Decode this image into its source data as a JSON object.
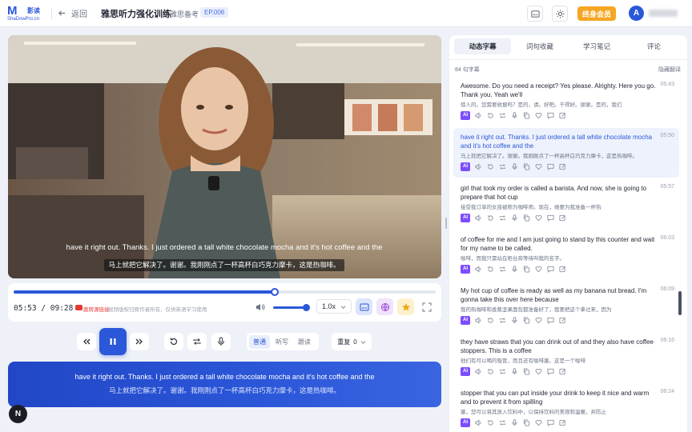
{
  "header": {
    "logo_mark": "M",
    "logo_cn": "影读",
    "logo_sub": "ShaDowPro.cn",
    "back_label": "返回",
    "course_title": "雅思听力强化训练",
    "course_subtitle": "雅思备考",
    "episode": "EP.006",
    "vip_label": "终身会员",
    "avatar_initial": "A"
  },
  "video": {
    "subtitle_en": "have it right out. Thanks. I just ordered a tall white chocolate mocha and it's hot coffee and the",
    "subtitle_zh": "马上就把它解决了。谢谢。我刚刚点了一杯高杯白巧克力摩卡，这是热咖啡。"
  },
  "player": {
    "progress": 0.618,
    "time_display": "05:53 / 09:28",
    "jump_link": "跳转源链接",
    "notice": "视频版权归原作者所有，仅供英语学习使用",
    "volume": 0.95,
    "speed": "1.0x",
    "tools": [
      {
        "icon": "subtitle-icon",
        "color": "#dbe5fb"
      },
      {
        "icon": "globe-icon",
        "color": "#f1e3fb"
      },
      {
        "icon": "star-icon",
        "color": "#fdf1cc"
      }
    ]
  },
  "controls": {
    "modes": [
      "普通",
      "听写",
      "跟读"
    ],
    "active_mode": "普通",
    "repeat_label": "重复",
    "repeat_value": "0"
  },
  "subtitle_card": {
    "en": "have it right out. Thanks. I just ordered a tall white chocolate mocha and it's hot coffee and the",
    "zh": "马上就把它解决了。谢谢。我刚刚点了一杯高杯白巧克力摩卡，这是热咖啡。"
  },
  "floating_badge": "N",
  "panel": {
    "tabs": [
      "动态字幕",
      "词句收藏",
      "学习笔记",
      "评论"
    ],
    "active_tab": "动态字幕",
    "count": "84 句字幕",
    "hide_translation": "隐藏翻译",
    "items": [
      {
        "en": "Awesome. Do you need a receipt? Yes please. Alrighty. Here you go. Thank you. Yeah we'll",
        "zh": "惊人的。您需要收据吗？是的，请。好吧。干得好。谢谢。是的，我们",
        "time": "05:43",
        "active": false
      },
      {
        "en": "have it right out. Thanks. I just ordered a tall white chocolate mocha and it's hot coffee and the",
        "zh": "马上就把它解决了。谢谢。我刚刚点了一杯高杯白巧克力摩卡，这是热咖啡。",
        "time": "05:50",
        "active": true
      },
      {
        "en": "girl that took my order is called a barista. And now, she is going to prepare that hot cup",
        "zh": "接受我订单的女孩被称为咖啡师。现在，她要为我准备一杯热",
        "time": "05:57",
        "active": false
      },
      {
        "en": "of coffee for me and I am just going to stand by this counter and wait for my name to be called.",
        "zh": "咖啡，而我只需站在柜台旁等待叫我的名字。",
        "time": "06:03",
        "active": false
      },
      {
        "en": "My hot cup of coffee is ready as well as my banana nut bread. I'm gonna take this over here because",
        "zh": "我的热咖啡和香蕉坚果面包都准备好了，我要把这个拿过来，因为",
        "time": "06:09",
        "active": false
      },
      {
        "en": "they have straws that you can drink out of and they also have coffee stoppers. This is a coffee",
        "zh": "他们有可以喝的吸管，而且还有咖啡塞。这是一个咖啡",
        "time": "06:16",
        "active": false
      },
      {
        "en": "stopper that you can put inside your drink to keep it nice and warm and to prevent it from spilling",
        "zh": "塞，您可以将其放入饮料中，以保持饮料的美观和温暖，并防止",
        "time": "06:24",
        "active": false
      }
    ]
  }
}
